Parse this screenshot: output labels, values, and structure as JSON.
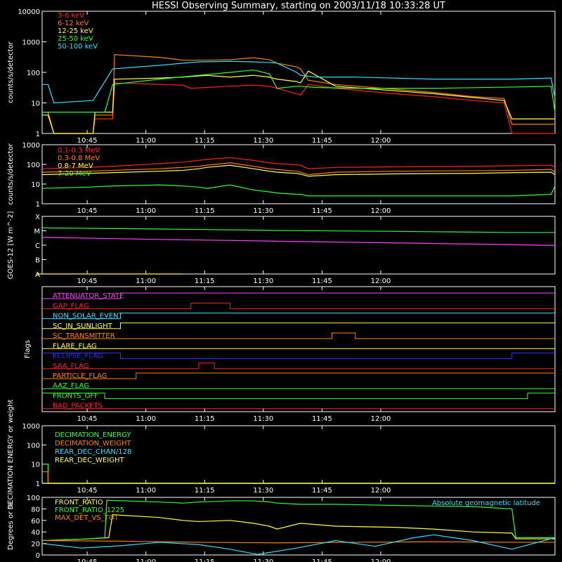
{
  "title": "HESSI Observing Summary, starting on 2003/11/18 10:33:28 UT",
  "x_ticks": [
    "10:45",
    "11:00",
    "11:15",
    "11:30",
    "11:45",
    "12:00"
  ],
  "chart_data": [
    {
      "type": "line",
      "name": "low-energy-rates",
      "ylabel": "counts/s/detector",
      "yscale": "log",
      "ylim": [
        1,
        10000
      ],
      "y_ticks": [
        "1",
        "10",
        "100",
        "1000",
        "10000"
      ],
      "x_range_min": [
        0,
        131
      ],
      "series": [
        {
          "name": "3-6 keV",
          "color": "#ff2020",
          "x": [
            0,
            1.5,
            3,
            13,
            13.5,
            18,
            18.5,
            36,
            38,
            42,
            48,
            54,
            58,
            60,
            65,
            66,
            68,
            75,
            90,
            100,
            110,
            118,
            120,
            131
          ],
          "y": [
            5,
            5,
            1,
            1,
            3,
            3,
            45,
            38,
            30,
            32,
            35,
            38,
            35,
            30,
            20,
            18,
            40,
            30,
            20,
            16,
            12,
            10,
            1,
            1
          ]
        },
        {
          "name": "6-12 keV",
          "color": "#ff8000",
          "x": [
            0,
            1.5,
            3,
            13,
            13.5,
            18,
            18.5,
            30,
            36,
            42,
            48,
            54,
            58,
            60,
            65,
            66,
            68,
            75,
            90,
            100,
            110,
            118,
            120,
            131
          ],
          "y": [
            5,
            5,
            1,
            1,
            4,
            4,
            380,
            310,
            250,
            250,
            260,
            300,
            260,
            200,
            150,
            130,
            55,
            40,
            28,
            22,
            16,
            14,
            2,
            2
          ]
        },
        {
          "name": "12-25 keV",
          "color": "#ffff40",
          "x": [
            0,
            1.5,
            3,
            13,
            13.5,
            18,
            18.5,
            30,
            36,
            42,
            48,
            54,
            58,
            60,
            65,
            66,
            68,
            75,
            90,
            100,
            110,
            118,
            120,
            131
          ],
          "y": [
            4,
            4,
            1,
            1,
            5,
            5,
            60,
            65,
            70,
            80,
            70,
            80,
            70,
            60,
            50,
            45,
            110,
            35,
            25,
            20,
            15,
            12,
            3,
            3
          ]
        },
        {
          "name": "25-50 keV",
          "color": "#30ff30",
          "x": [
            0,
            1.5,
            3,
            13,
            16,
            18,
            30,
            40,
            48,
            54,
            58,
            60,
            65,
            66,
            70,
            80,
            100,
            120,
            130,
            131
          ],
          "y": [
            5,
            5,
            5,
            5,
            5,
            40,
            60,
            80,
            100,
            120,
            90,
            30,
            35,
            35,
            32,
            30,
            30,
            33,
            35,
            5
          ]
        },
        {
          "name": "50-100 keV",
          "color": "#30e0ff",
          "x": [
            0,
            1.5,
            3,
            13,
            18,
            30,
            36,
            40,
            48,
            54,
            58,
            60,
            65,
            66,
            70,
            80,
            100,
            120,
            130,
            131
          ],
          "y": [
            40,
            40,
            10,
            12,
            130,
            170,
            200,
            220,
            230,
            220,
            210,
            200,
            100,
            80,
            70,
            70,
            60,
            60,
            65,
            15
          ]
        }
      ]
    },
    {
      "type": "line",
      "name": "high-energy-rates",
      "ylabel": "counts/s/detector",
      "yscale": "log",
      "ylim": [
        1,
        1000
      ],
      "y_ticks": [
        "1",
        "10",
        "100",
        "1000"
      ],
      "series": [
        {
          "name": "0.1-0.3 MeV",
          "color": "#ff2020",
          "x": [
            0,
            12,
            18,
            30,
            36,
            40,
            42,
            48,
            54,
            58,
            60,
            65,
            66,
            68,
            75,
            90,
            110,
            120,
            130,
            131
          ],
          "y": [
            60,
            70,
            80,
            110,
            130,
            160,
            180,
            220,
            160,
            120,
            110,
            95,
            90,
            60,
            70,
            75,
            80,
            85,
            90,
            70
          ]
        },
        {
          "name": "0.3-0.8 MeV",
          "color": "#ff8000",
          "x": [
            0,
            12,
            18,
            30,
            36,
            40,
            42,
            48,
            54,
            58,
            60,
            65,
            66,
            68,
            75,
            90,
            110,
            120,
            130,
            131
          ],
          "y": [
            40,
            45,
            50,
            60,
            70,
            80,
            90,
            120,
            80,
            60,
            55,
            45,
            40,
            30,
            40,
            45,
            48,
            50,
            55,
            40
          ]
        },
        {
          "name": "0.8-7 MeV",
          "color": "#ffff40",
          "x": [
            0,
            12,
            18,
            30,
            36,
            40,
            42,
            48,
            54,
            58,
            60,
            65,
            66,
            68,
            75,
            90,
            110,
            120,
            130,
            131
          ],
          "y": [
            30,
            35,
            38,
            45,
            50,
            60,
            70,
            90,
            60,
            45,
            40,
            35,
            32,
            25,
            30,
            33,
            35,
            38,
            40,
            30
          ]
        },
        {
          "name": "7-20 MeV",
          "color": "#30ff30",
          "x": [
            0,
            12,
            18,
            30,
            36,
            40,
            42,
            48,
            54,
            58,
            60,
            65,
            66,
            68,
            80,
            100,
            120,
            130,
            131
          ],
          "y": [
            6,
            7,
            8,
            9,
            8,
            7,
            6,
            9,
            5,
            4,
            3.5,
            3,
            3,
            2.5,
            2.5,
            2.5,
            2.5,
            3,
            8
          ]
        }
      ]
    },
    {
      "type": "line",
      "name": "goes",
      "ylabel": "GOES-12 [W m^-2]",
      "yscale": "log",
      "ylim": [
        1e-08,
        0.001
      ],
      "y_ticks": [
        "A",
        "B",
        "C",
        "M",
        "X"
      ],
      "series": [
        {
          "color": "#30ff30",
          "x": [
            0,
            30,
            60,
            90,
            120,
            131
          ],
          "y": [
            0.0001,
            8e-05,
            6e-05,
            5e-05,
            4e-05,
            4e-05
          ]
        },
        {
          "color": "#ff40ff",
          "x": [
            0,
            30,
            60,
            90,
            120,
            131
          ],
          "y": [
            1.5e-05,
            1e-05,
            7e-06,
            5e-06,
            3.5e-06,
            3e-06
          ]
        },
        {
          "color": "#ffff40",
          "x": [
            -10,
            36
          ],
          "y": [
            1e-08,
            1e-08
          ]
        }
      ]
    },
    {
      "type": "line",
      "name": "flags",
      "ylabel": "Flags",
      "series": [
        {
          "name": "ATTENUATOR_STATE",
          "color": "#ff40ff",
          "x": [
            0,
            20,
            20,
            131
          ],
          "y": [
            0,
            0,
            1,
            1
          ]
        },
        {
          "name": "GAP_FLAG",
          "color": "#ff2020",
          "x": [
            0,
            38,
            38,
            48,
            48,
            131
          ],
          "y": [
            0,
            0,
            1,
            1,
            0,
            0
          ]
        },
        {
          "name": "NON_SOLAR_EVENT",
          "color": "#30e0ff",
          "x": [
            0,
            20,
            20,
            131
          ],
          "y": [
            0,
            0,
            1,
            1
          ]
        },
        {
          "name": "SC_IN_SUNLIGHT",
          "color": "#ffff40",
          "x": [
            0,
            20,
            20,
            131
          ],
          "y": [
            0,
            0,
            1,
            1
          ]
        },
        {
          "name": "SC_TRANSMITTER",
          "color": "#ff8000",
          "x": [
            0,
            74,
            74,
            80,
            80,
            131
          ],
          "y": [
            0,
            0,
            1,
            1,
            0,
            0
          ]
        },
        {
          "name": "FLARE_FLAG",
          "color": "#ffff40",
          "x": [
            0,
            131
          ],
          "y": [
            0,
            0
          ]
        },
        {
          "name": "ECLIPSE_FLAG",
          "color": "#3030ff",
          "x": [
            0,
            20,
            20,
            120,
            120,
            131
          ],
          "y": [
            1,
            1,
            0,
            0,
            1,
            1
          ]
        },
        {
          "name": "SAA_FLAG",
          "color": "#ff2020",
          "x": [
            0,
            40,
            40,
            44,
            44,
            131
          ],
          "y": [
            0,
            0,
            1,
            1,
            0,
            0
          ]
        },
        {
          "name": "PARTICLE_FLAG",
          "color": "#ff8000",
          "x": [
            0,
            24,
            24,
            131
          ],
          "y": [
            0,
            0,
            1,
            1
          ]
        },
        {
          "name": "AAZ_FLAG",
          "color": "#30ff30",
          "x": [
            0,
            20,
            20,
            131
          ],
          "y": [
            0,
            0,
            0,
            0
          ]
        },
        {
          "name": "FRONTS_OFF",
          "color": "#30ff30",
          "x": [
            0,
            16,
            16,
            124,
            124,
            131
          ],
          "y": [
            1,
            1,
            0,
            0,
            1,
            1
          ]
        },
        {
          "name": "BAD_PACKETS",
          "color": "#ff2020",
          "x": [
            0,
            131
          ],
          "y": [
            0,
            0
          ]
        }
      ]
    },
    {
      "type": "line",
      "name": "decimation",
      "ylabel": "DECIMATION ENERGY or weight",
      "yscale": "log",
      "ylim": [
        1,
        1000
      ],
      "y_ticks": [
        "1",
        "10",
        "100",
        "1000"
      ],
      "series": [
        {
          "name": "DECIMATION_ENERGY",
          "color": "#30ff30",
          "x": [
            0,
            1.5,
            1.5,
            131
          ],
          "y": [
            10,
            10,
            1,
            1
          ]
        },
        {
          "name": "DECIMATION_WEIGHT",
          "color": "#ff8000",
          "x": [
            0,
            1.5,
            1.5,
            131
          ],
          "y": [
            4,
            4,
            1,
            1
          ]
        },
        {
          "name": "REAR_DEC_CHAN/128",
          "color": "#30e0ff",
          "x": [
            0,
            131
          ],
          "y": [
            1,
            1
          ]
        },
        {
          "name": "REAR_DEC_WEIGHT",
          "color": "#ffff40",
          "x": [
            0,
            131
          ],
          "y": [
            1,
            1
          ]
        }
      ]
    },
    {
      "type": "line",
      "name": "ratios",
      "ylabel": "Degrees or %",
      "ylim": [
        0,
        100
      ],
      "y_ticks": [
        "0",
        "20",
        "40",
        "60",
        "80",
        "100"
      ],
      "annotation": "Absolute geomagnetic latitude",
      "series": [
        {
          "name": "FRONT_RATIO",
          "color": "#ffff40",
          "x": [
            0,
            12,
            17,
            18,
            30,
            36,
            40,
            48,
            54,
            58,
            60,
            66,
            75,
            90,
            100,
            110,
            120,
            121,
            131
          ],
          "y": [
            25,
            28,
            30,
            70,
            65,
            60,
            58,
            60,
            55,
            50,
            45,
            55,
            50,
            48,
            45,
            40,
            38,
            28,
            28
          ]
        },
        {
          "name": "FRONT_RATIO_1225",
          "color": "#30ff30",
          "x": [
            0,
            12,
            16,
            16.5,
            30,
            36,
            40,
            48,
            54,
            58,
            60,
            66,
            75,
            90,
            100,
            110,
            120,
            121,
            131
          ],
          "y": [
            25,
            28,
            30,
            95,
            92,
            90,
            92,
            94,
            94,
            92,
            90,
            88,
            88,
            86,
            85,
            84,
            80,
            30,
            30
          ]
        },
        {
          "name": "MAX_DET_VS_TOT",
          "color": "#ff8000",
          "x": [
            0,
            20,
            40,
            60,
            80,
            100,
            120,
            131
          ],
          "y": [
            25,
            24,
            22,
            21,
            22,
            23,
            22,
            22
          ]
        },
        {
          "name": "Absolute geomagnetic latitude",
          "color": "#30e0ff",
          "x": [
            0,
            10,
            20,
            30,
            40,
            48,
            55,
            65,
            75,
            85,
            95,
            100,
            110,
            120,
            131
          ],
          "y": [
            20,
            12,
            16,
            22,
            18,
            10,
            1,
            12,
            25,
            15,
            30,
            35,
            25,
            10,
            30
          ]
        }
      ]
    }
  ]
}
